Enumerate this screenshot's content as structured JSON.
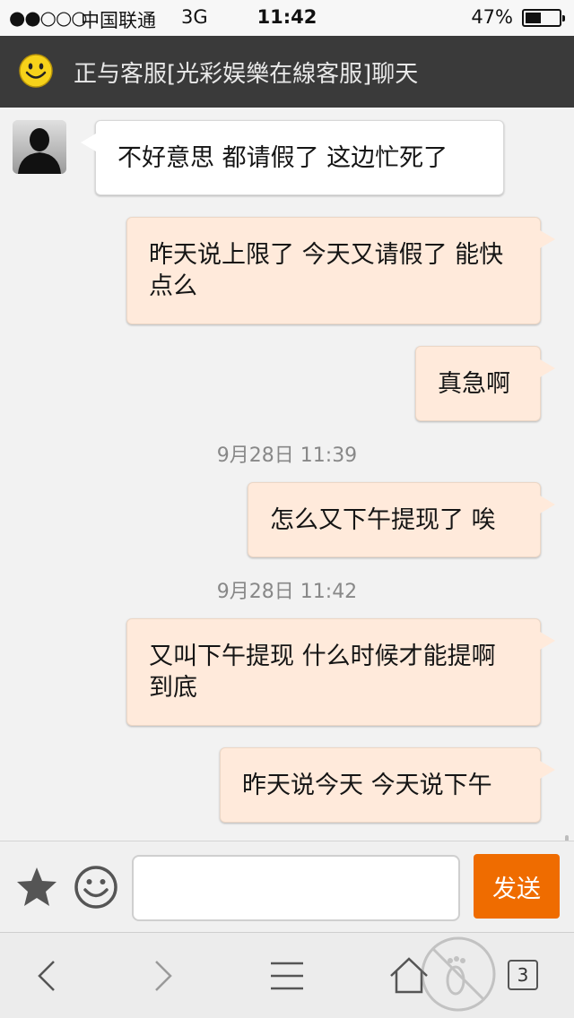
{
  "status_bar": {
    "signal": "●●○○○",
    "carrier": "中国联通",
    "network": "3G",
    "time": "11:42",
    "battery_percent": "47%",
    "battery_level": 0.47
  },
  "header": {
    "icon": "smiley-icon",
    "title": "正与客服[光彩娱樂在線客服]聊天"
  },
  "messages": [
    {
      "side": "left",
      "text": "不好意思 都请假了 这边忙死了"
    },
    {
      "side": "right",
      "text": "昨天说上限了 今天又请假了 能快点么"
    },
    {
      "side": "right",
      "text": "真急啊"
    },
    {
      "type": "timestamp",
      "text": "9月28日 11:39"
    },
    {
      "side": "right",
      "text": "怎么又下午提现了 唉"
    },
    {
      "type": "timestamp",
      "text": "9月28日 11:42"
    },
    {
      "side": "right",
      "text": "又叫下午提现 什么时候才能提啊到底"
    },
    {
      "side": "right",
      "text": "昨天说今天 今天说下午"
    }
  ],
  "input_bar": {
    "star_icon": "star-icon",
    "emoji_icon": "emoji-icon",
    "input_value": "",
    "input_placeholder": "",
    "send_label": "发送"
  },
  "toolbar": {
    "back_icon": "chevron-left-icon",
    "forward_icon": "chevron-right-icon",
    "menu_icon": "menu-icon",
    "home_icon": "home-icon",
    "tab_count": "3"
  },
  "colors": {
    "header_bg": "#3a3a3a",
    "incoming_bubble": "#ffffff",
    "outgoing_bubble": "#ffeadb",
    "send_button": "#ef6c00"
  }
}
